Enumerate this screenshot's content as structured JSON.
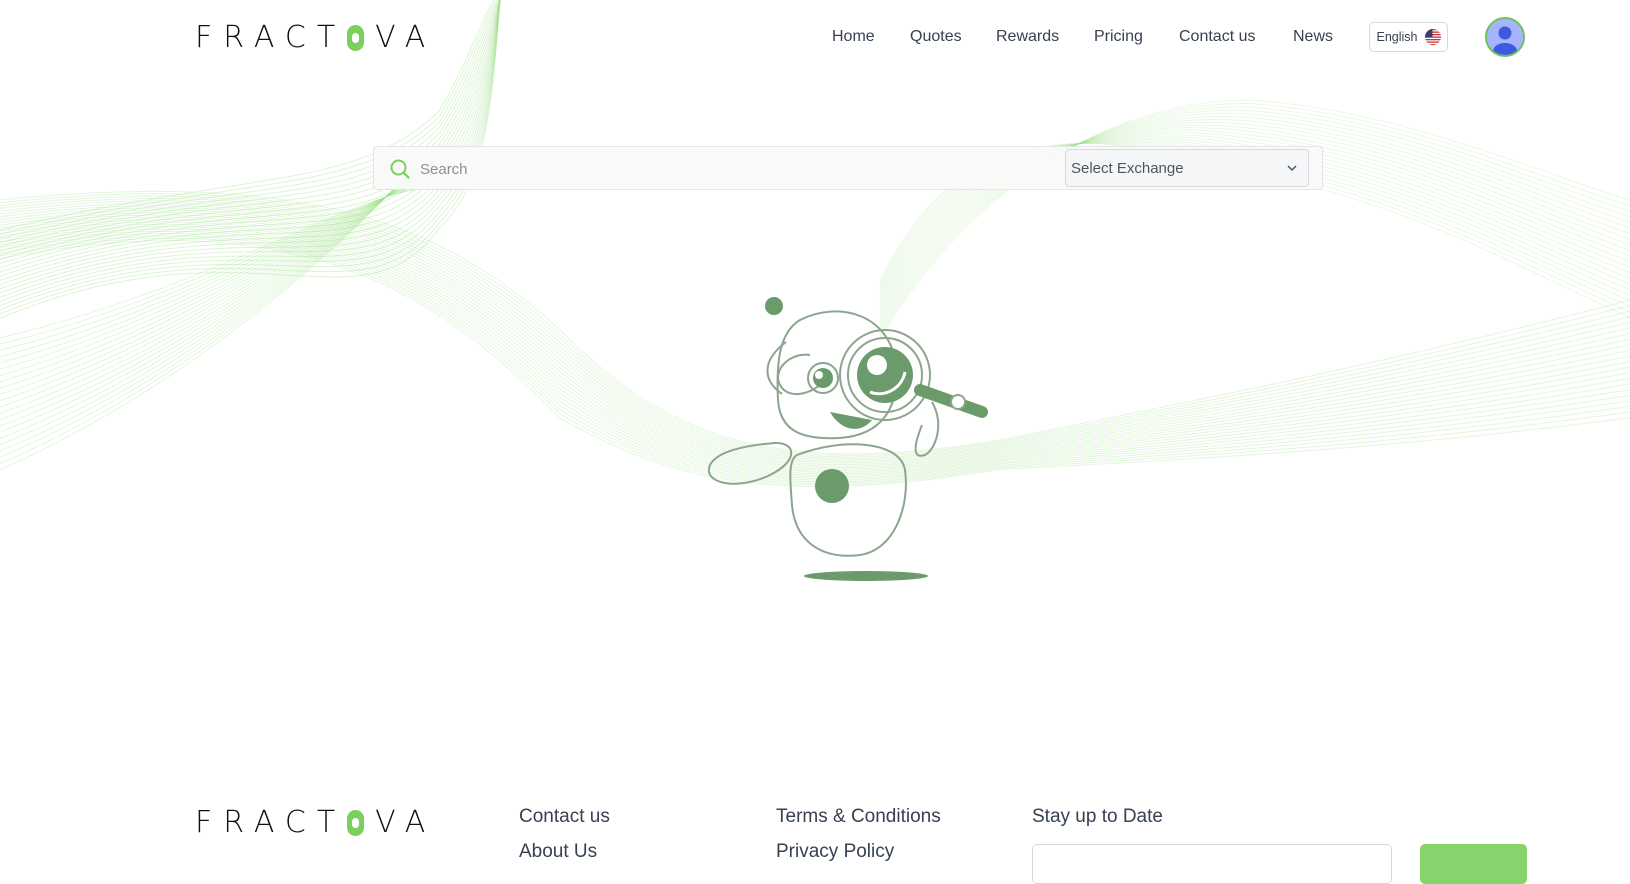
{
  "brand": {
    "logo_left": "FRACT",
    "logo_right": "VA",
    "accent_color": "#7ccf5b"
  },
  "nav": {
    "items": [
      {
        "label": "Home"
      },
      {
        "label": "Quotes"
      },
      {
        "label": "Rewards"
      },
      {
        "label": "Pricing"
      },
      {
        "label": "Contact us"
      },
      {
        "label": "News"
      }
    ],
    "language": "English",
    "flag_icon": "us-flag-icon",
    "avatar_icon": "user-avatar-icon"
  },
  "search": {
    "placeholder": "Search",
    "value": "",
    "exchange_placeholder": "Select Exchange"
  },
  "illustration": {
    "icon": "robot-with-magnifying-glass-icon",
    "color": "#6b9a6b"
  },
  "footer": {
    "col1": [
      "Contact us",
      "About Us"
    ],
    "col2": [
      "Terms & Conditions",
      "Privacy Policy"
    ],
    "newsletter_title": "Stay up to Date",
    "button_color": "#86d46b"
  }
}
